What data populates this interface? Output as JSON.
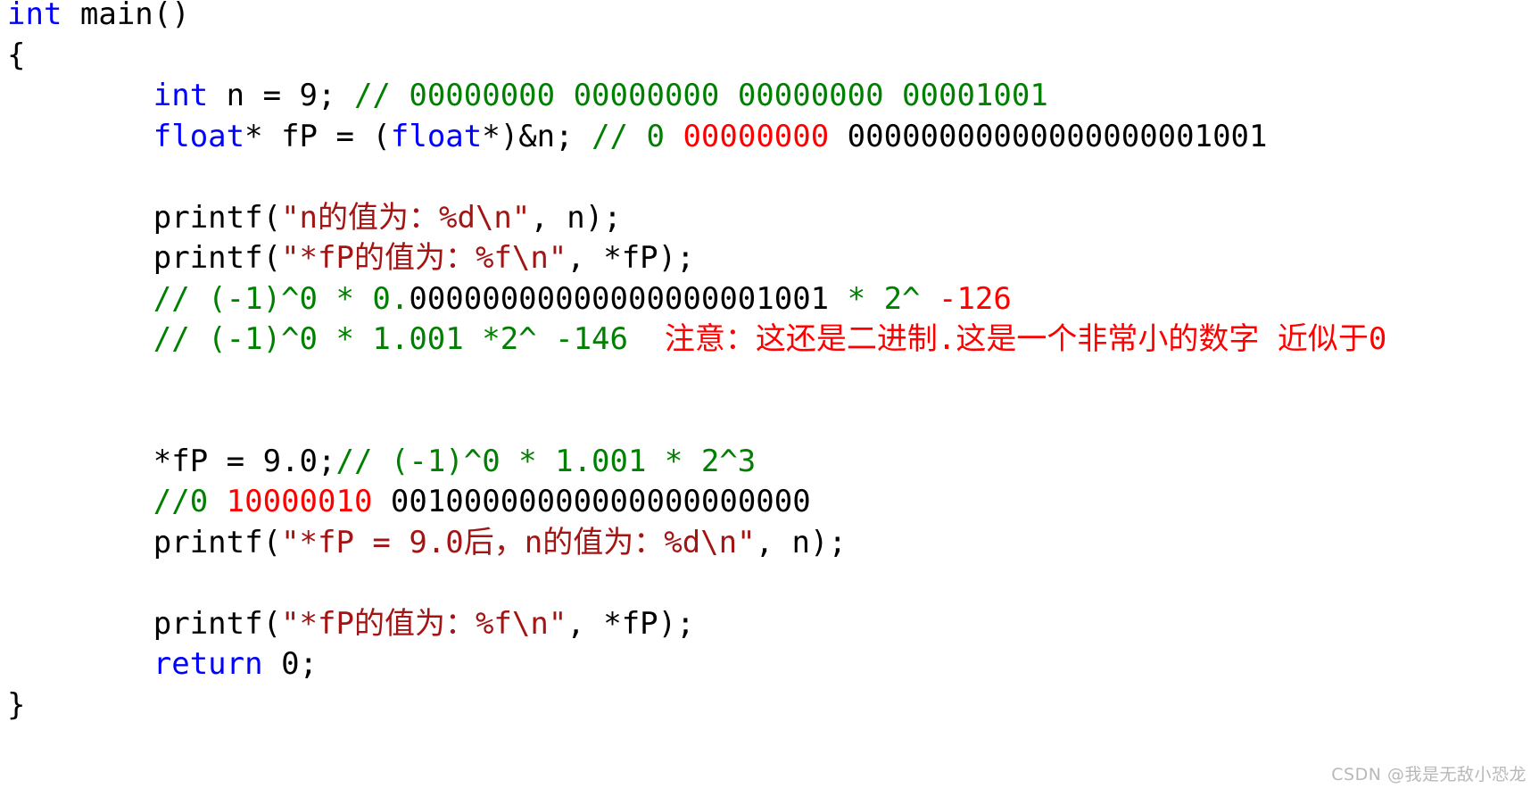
{
  "editor": {
    "language": "c",
    "colors": {
      "background": "#ffffff",
      "keyword": "#0000ff",
      "comment": "#008000",
      "string": "#a31515",
      "highlight_red": "#ff0000",
      "plain_text": "#000000",
      "watermark": "#b8b8b8"
    },
    "lines": [
      {
        "id": "line-1",
        "tokens": [
          {
            "t": "int",
            "c": "kw"
          },
          {
            "t": " main()",
            "c": "plain"
          }
        ]
      },
      {
        "id": "line-2",
        "tokens": [
          {
            "t": "{",
            "c": "plain"
          }
        ]
      },
      {
        "id": "line-3",
        "tokens": [
          {
            "t": "        ",
            "c": "plain"
          },
          {
            "t": "int",
            "c": "kw"
          },
          {
            "t": " n = 9; ",
            "c": "plain"
          },
          {
            "t": "// 00000000 00000000 00000000 00001001",
            "c": "cmt"
          }
        ]
      },
      {
        "id": "line-4",
        "tokens": [
          {
            "t": "        ",
            "c": "plain"
          },
          {
            "t": "float",
            "c": "kw"
          },
          {
            "t": "* fP = (",
            "c": "plain"
          },
          {
            "t": "float",
            "c": "kw"
          },
          {
            "t": "*)&n; ",
            "c": "plain"
          },
          {
            "t": "// 0 ",
            "c": "cmt"
          },
          {
            "t": "00000000",
            "c": "red"
          },
          {
            "t": " 00000000000000000001001",
            "c": "plain"
          }
        ]
      },
      {
        "id": "line-5",
        "tokens": []
      },
      {
        "id": "line-6",
        "tokens": [
          {
            "t": "        printf(",
            "c": "plain"
          },
          {
            "t": "\"n的值为：%d\\n\"",
            "c": "str"
          },
          {
            "t": ", n);",
            "c": "plain"
          }
        ]
      },
      {
        "id": "line-7",
        "tokens": [
          {
            "t": "        printf(",
            "c": "plain"
          },
          {
            "t": "\"*fP的值为：%f\\n\"",
            "c": "str"
          },
          {
            "t": ", *fP);",
            "c": "plain"
          }
        ]
      },
      {
        "id": "line-8",
        "tokens": [
          {
            "t": "        ",
            "c": "plain"
          },
          {
            "t": "// (-1)^0 * 0.",
            "c": "cmt"
          },
          {
            "t": "00000000000000000001001",
            "c": "plain"
          },
          {
            "t": " * 2^ ",
            "c": "cmt"
          },
          {
            "t": "-126",
            "c": "red"
          }
        ]
      },
      {
        "id": "line-9",
        "tokens": [
          {
            "t": "        ",
            "c": "plain"
          },
          {
            "t": "// (-1)^0 * 1.001 *2^ -146  ",
            "c": "cmt"
          },
          {
            "t": "注意：这还是二进制.这是一个非常小的数字 近似于0",
            "c": "red"
          }
        ]
      },
      {
        "id": "line-10",
        "tokens": []
      },
      {
        "id": "line-11",
        "tokens": []
      },
      {
        "id": "line-12",
        "tokens": [
          {
            "t": "        *fP = 9.0;",
            "c": "plain"
          },
          {
            "t": "// (-1)^0 * 1.001 * 2^3",
            "c": "cmt"
          }
        ]
      },
      {
        "id": "line-13",
        "tokens": [
          {
            "t": "        ",
            "c": "plain"
          },
          {
            "t": "//0 ",
            "c": "cmt"
          },
          {
            "t": "10000010",
            "c": "red"
          },
          {
            "t": " 00100000000000000000000",
            "c": "plain"
          }
        ]
      },
      {
        "id": "line-14",
        "tokens": [
          {
            "t": "        printf(",
            "c": "plain"
          },
          {
            "t": "\"*fP = 9.0后，n的值为：%d\\n\"",
            "c": "str"
          },
          {
            "t": ", n);",
            "c": "plain"
          }
        ]
      },
      {
        "id": "line-15",
        "tokens": []
      },
      {
        "id": "line-16",
        "tokens": [
          {
            "t": "        printf(",
            "c": "plain"
          },
          {
            "t": "\"*fP的值为：%f\\n\"",
            "c": "str"
          },
          {
            "t": ", *fP);",
            "c": "plain"
          }
        ]
      },
      {
        "id": "line-17",
        "tokens": [
          {
            "t": "        ",
            "c": "plain"
          },
          {
            "t": "return",
            "c": "kw"
          },
          {
            "t": " 0;",
            "c": "plain"
          }
        ]
      },
      {
        "id": "line-18",
        "tokens": [
          {
            "t": "}",
            "c": "plain"
          }
        ]
      }
    ]
  },
  "watermark": {
    "text": "CSDN @我是无敌小恐龙"
  }
}
